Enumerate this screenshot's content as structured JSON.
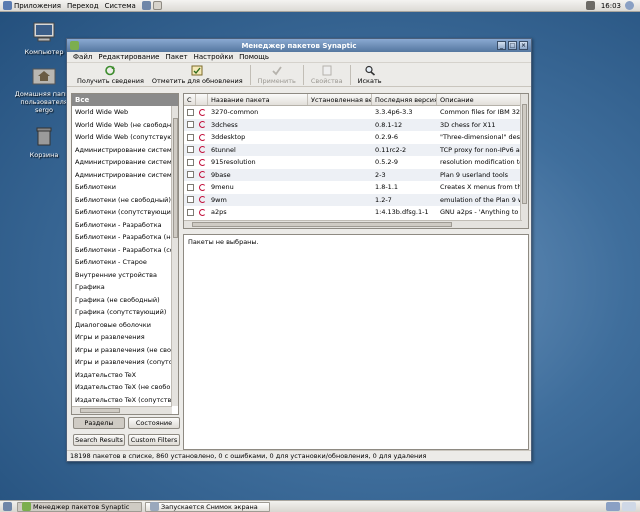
{
  "top_panel": {
    "menus": [
      "Приложения",
      "Переход",
      "Система"
    ],
    "clock": "16:03"
  },
  "desktop": {
    "icons": [
      {
        "label": "Компьютер",
        "icon": "computer-icon"
      },
      {
        "label": "Домашняя папка пользователя sergo",
        "icon": "home-folder-icon"
      },
      {
        "label": "Корзина",
        "icon": "trash-icon"
      }
    ]
  },
  "window": {
    "title": "Менеджер пакетов Synaptic",
    "menu": [
      "Файл",
      "Редактирование",
      "Пакет",
      "Настройки",
      "Помощь"
    ],
    "toolbar": [
      {
        "label": "Получить сведения",
        "icon": "reload-icon",
        "enabled": true
      },
      {
        "label": "Отметить для обновления",
        "icon": "mark-upgrade-icon",
        "enabled": true
      },
      {
        "label": "Применить",
        "icon": "apply-check-icon",
        "enabled": false
      },
      {
        "label": "Свойства",
        "icon": "properties-icon",
        "enabled": false
      },
      {
        "label": "Искать",
        "icon": "search-icon",
        "enabled": true
      }
    ],
    "sections_header": "Все",
    "sections": [
      "World Wide Web",
      "World Wide Web (не свободный)",
      "World Wide Web (сопутствующий)",
      "Администрирование системы",
      "Администрирование системы",
      "Администрирование системы",
      "Библиотеки",
      "Библиотеки (не свободный)",
      "Библиотеки (сопутствующий)",
      "Библиотеки - Разработка",
      "Библиотеки - Разработка (не",
      "Библиотеки - Разработка (со",
      "Библиотеки - Старое",
      "Внутренние устройства",
      "Графика",
      "Графика (не свободный)",
      "Графика (сопутствующий)",
      "Диалоговые оболочки",
      "Игры и развлечения",
      "Игры и развлечения (не своб",
      "Игры и развлечения (сопутст",
      "Издательство TeX",
      "Издательство TeX (не свобо",
      "Издательство TeX (сопутству"
    ],
    "filter_buttons": [
      "Разделы",
      "Состояние",
      "Search Results",
      "Custom Filters"
    ],
    "columns": [
      "С",
      "",
      "Название пакета",
      "Установленная версия",
      "Последняя версия",
      "Описание"
    ],
    "packages": [
      {
        "name": "3270-common",
        "installed": "",
        "latest": "3.3.4p6-3.3",
        "desc": "Common files for IBM 3270"
      },
      {
        "name": "3dchess",
        "installed": "",
        "latest": "0.8.1-12",
        "desc": "3D chess for X11"
      },
      {
        "name": "3ddesktop",
        "installed": "",
        "latest": "0.2.9-6",
        "desc": "\"Three-dimensional\" desk"
      },
      {
        "name": "6tunnel",
        "installed": "",
        "latest": "0.11rc2-2",
        "desc": "TCP proxy for non-IPv6 ap"
      },
      {
        "name": "915resolution",
        "installed": "",
        "latest": "0.5.2-9",
        "desc": "resolution modification to"
      },
      {
        "name": "9base",
        "installed": "",
        "latest": "2-3",
        "desc": "Plan 9 userland tools"
      },
      {
        "name": "9menu",
        "installed": "",
        "latest": "1.8-1.1",
        "desc": "Creates X menus from the"
      },
      {
        "name": "9wm",
        "installed": "",
        "latest": "1.2-7",
        "desc": "emulation of the Plan 9 w"
      },
      {
        "name": "a2ps",
        "installed": "",
        "latest": "1:4.13b.dfsg.1-1",
        "desc": "GNU a2ps - 'Anything to P"
      }
    ],
    "description_text": "Пакеты не выбраны.",
    "status": "18198 пакетов в списке, 860 установлено, 0 с ошибками, 0 для установки/обновления, 0 для удаления"
  },
  "taskbar": {
    "tasks": [
      "Менеджер пакетов Synaptic",
      "Запускается Снимок экрана"
    ]
  },
  "colors": {
    "title_bar": "#6a8ab4",
    "desktop": "#3f6e9c",
    "row_alt": "#edf0f5",
    "debian_red": "#c2113c"
  }
}
